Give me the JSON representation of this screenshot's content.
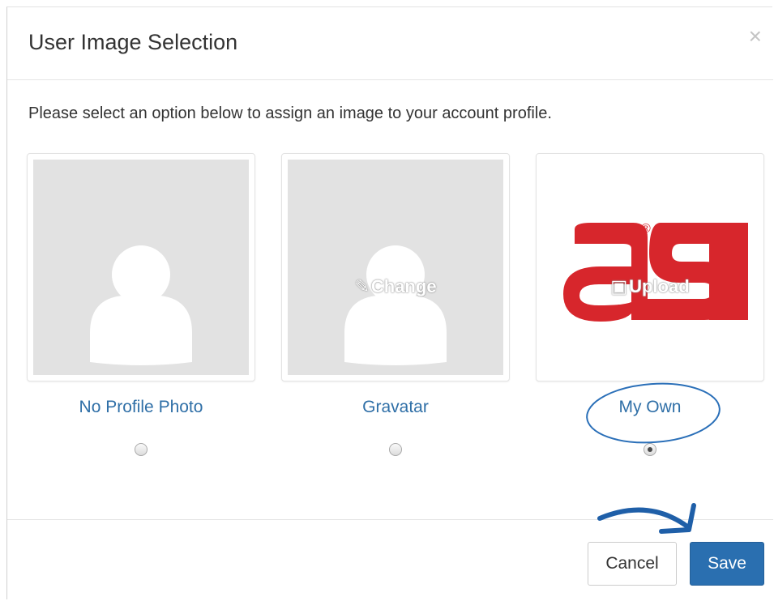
{
  "dialog": {
    "title": "User Image Selection",
    "close_glyph": "×",
    "intro": "Please select an option below to assign an image to your account profile."
  },
  "options": [
    {
      "label": "No Profile Photo",
      "overlay": "",
      "selected": false
    },
    {
      "label": "Gravatar",
      "overlay": "Change",
      "overlay_icon": "pencil-icon",
      "selected": false
    },
    {
      "label": "My Own",
      "overlay": "Upload",
      "overlay_icon": "picture-icon",
      "selected": true,
      "logo_text": "asi",
      "logo_mark": "®"
    }
  ],
  "footer": {
    "cancel_label": "Cancel",
    "save_label": "Save"
  },
  "colors": {
    "link": "#2f6fa7",
    "primary": "#2a6fb0",
    "logo_red": "#d7262c",
    "annotation_blue": "#2a6fb8",
    "placeholder_bg": "#e2e2e2"
  }
}
